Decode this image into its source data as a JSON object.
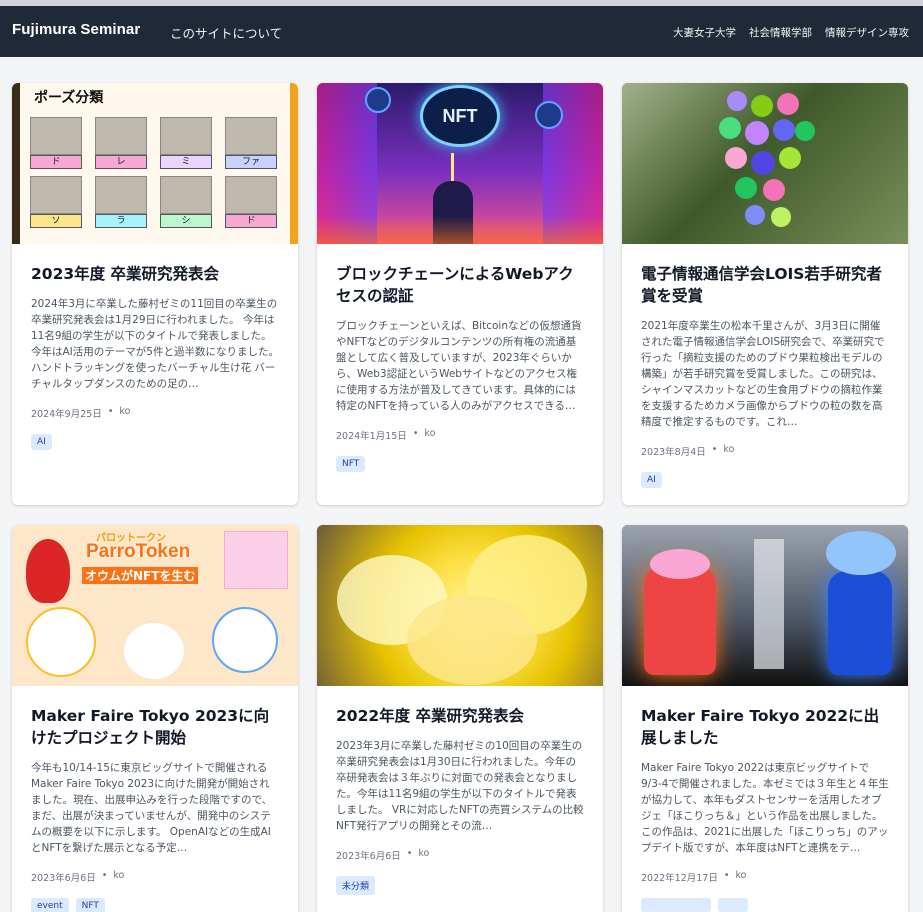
{
  "navbar": {
    "brand": "Fujimura Seminar",
    "about": "このサイトについて",
    "links": [
      "大妻女子大学",
      "社会情報学部",
      "情報デザイン専攻"
    ]
  },
  "posts": [
    {
      "title": "2023年度 卒業研究発表会",
      "excerpt": "2024年3月に卒業した藤村ゼミの11回目の卒業生の卒業研究発表会は1月29日に行われました。 今年は11名9組の学生が以下のタイトルで発表しました。今年はAI活用のテーマが5件と過半数になりました。 ハンドトラッキングを使ったバーチャル生け花 バーチャルタップダンスのための足の…",
      "date": "2024年9月25日",
      "author": "ko",
      "tags": [
        "AI"
      ],
      "image": {
        "heading": "ポーズ分類",
        "notes": [
          "ド",
          "レ",
          "ミ",
          "ファ",
          "ソ",
          "ラ",
          "シ",
          "ド"
        ]
      }
    },
    {
      "title": "ブロックチェーンによるWebアクセスの認証",
      "excerpt": "ブロックチェーンといえば、Bitcoinなどの仮想通貨やNFTなどのデジタルコンテンツの所有権の流通基盤として広く普及していますが、2023年ぐらいから、Web3認証というWebサイトなどのアクセス権に使用する方法が普及してきています。具体的には特定のNFTを持っている人のみがアクセスできる…",
      "date": "2024年1月15日",
      "author": "ko",
      "tags": [
        "NFT"
      ],
      "image": {
        "label": "NFT"
      }
    },
    {
      "title": "電子情報通信学会LOIS若手研究者賞を受賞",
      "excerpt": "2021年度卒業生の松本千里さんが、3月3日に開催された電子情報通信学会LOIS研究会で、卒業研究で行った「摘粒支援のためのブドウ果粒検出モデルの構築」が若手研究賞を受賞しました。この研究は、シャインマスカットなどの生食用ブドウの摘粒作業を支援するためカメラ画像からブドウの粒の数を高精度で推定するものです。これ…",
      "date": "2023年8月4日",
      "author": "ko",
      "tags": [
        "AI"
      ]
    },
    {
      "title": "Maker Faire Tokyo 2023に向けたプロジェクト開始",
      "excerpt": "今年も10/14-15に東京ビッグサイトで開催されるMaker Faire Tokyo 2023に向けた開発が開始されました。現在、出展申込みを行った段階ですので、まだ、出展が決まっていませんが、開発中のシステムの概要を以下に示します。 OpenAIなどの生成AIとNFTを繋げた展示となる予定…",
      "date": "2023年6月6日",
      "author": "ko",
      "tags": [
        "event",
        "NFT"
      ],
      "image": {
        "kana": "パロットークン",
        "title": "ParroToken",
        "subtitle": "オウムがNFTを生む"
      }
    },
    {
      "title": "2022年度 卒業研究発表会",
      "excerpt": "2023年3月に卒業した藤村ゼミの10回目の卒業生の卒業研究発表会は1月30日に行われました。今年の卒研発表会は３年ぶりに対面での発表会となりました。今年は11名9組の学生が以下のタイトルで発表しました。 VRに対応したNFTの売買システムの比較 NFT発行アプリの開発とその流…",
      "date": "2023年6月6日",
      "author": "ko",
      "tags": [
        "未分類"
      ]
    },
    {
      "title": "Maker Faire Tokyo 2022に出展しました",
      "excerpt": "Maker Faire Tokyo 2022は東京ビッグサイトで9/3-4で開催されました。本ゼミでは３年生と４年生が協力して、本年もダストセンサーを活用したオブジェ「ほこりっち＆」という作品を出展しました。この作品は、2021に出展した「ほこりっち」のアップデイト版ですが、本年度はNFTと連携をテ…",
      "date": "2022年12月17日",
      "author": "ko",
      "tags": []
    }
  ]
}
